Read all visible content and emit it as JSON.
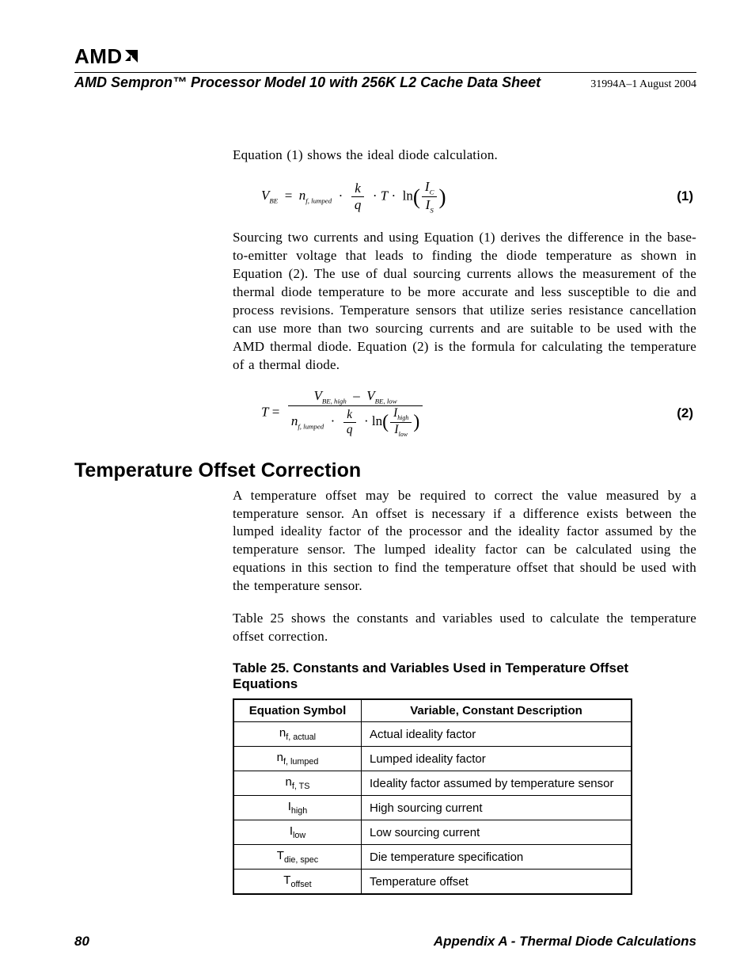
{
  "header": {
    "brand": "AMD",
    "doc_title": "AMD Sempron™ Processor Model 10 with 256K L2 Cache Data Sheet",
    "doc_rev": "31994A–1 August 2004"
  },
  "intro_para": "Equation (1) shows the ideal diode calculation.",
  "eq1_num": "(1)",
  "para2": "Sourcing two currents and using Equation (1) derives the difference in the base-to-emitter voltage that leads to finding the diode temperature as shown in Equation (2). The use of dual sourcing currents allows the measurement of the thermal diode temperature to be more accurate and less susceptible to die and process revisions. Temperature sensors that utilize series resistance cancellation can use more than two sourcing currents and are suitable to be used with the AMD thermal diode. Equation (2) is the formula for calculating the temperature of a thermal diode.",
  "eq2_num": "(2)",
  "section_heading": "Temperature Offset Correction",
  "para3": "A temperature offset may be required to correct the value measured by a temperature sensor.  An offset is necessary if a difference exists between the lumped ideality factor of the processor and the ideality factor assumed by the temperature sensor. The lumped ideality factor can be calculated using the equations in this section to find the temperature offset that should be used with the temperature sensor.",
  "para4": "Table 25 shows the constants and variables used to calculate the temperature offset correction.",
  "table25": {
    "caption": "Table 25.   Constants and Variables Used in Temperature Offset Equations",
    "col1": "Equation Symbol",
    "col2": "Variable, Constant Description",
    "rows": [
      {
        "sym_base": "n",
        "sym_sub": "f, actual",
        "desc": "Actual ideality factor"
      },
      {
        "sym_base": "n",
        "sym_sub": "f, lumped",
        "desc": "Lumped ideality factor"
      },
      {
        "sym_base": "n",
        "sym_sub": "f, TS",
        "desc": "Ideality factor assumed by temperature sensor"
      },
      {
        "sym_base": "I",
        "sym_sub": "high",
        "desc": "High sourcing current"
      },
      {
        "sym_base": "I",
        "sym_sub": "low",
        "desc": "Low sourcing current"
      },
      {
        "sym_base": "T",
        "sym_sub": "die, spec",
        "desc": "Die temperature specification"
      },
      {
        "sym_base": "T",
        "sym_sub": "offset",
        "desc": "Temperature offset"
      }
    ]
  },
  "footer": {
    "page": "80",
    "appendix": "Appendix A - Thermal Diode Calculations"
  },
  "equations": {
    "eq1": {
      "lhs_base": "V",
      "lhs_sub": "BE",
      "term1_base": "n",
      "term1_sub": "f, lumped",
      "frac_k": "k",
      "frac_q": "q",
      "T": "T",
      "ln": "ln",
      "ratio_top_base": "I",
      "ratio_top_sub": "C",
      "ratio_bot_base": "I",
      "ratio_bot_sub": "S"
    },
    "eq2": {
      "lhs": "T",
      "num_V1_base": "V",
      "num_V1_sub": "BE, high",
      "num_V2_base": "V",
      "num_V2_sub": "BE, low",
      "den_n_base": "n",
      "den_n_sub": "f, lumped",
      "frac_k": "k",
      "frac_q": "q",
      "ln": "ln",
      "ratio_top_base": "I",
      "ratio_top_sub": "high",
      "ratio_bot_base": "I",
      "ratio_bot_sub": "low"
    }
  }
}
